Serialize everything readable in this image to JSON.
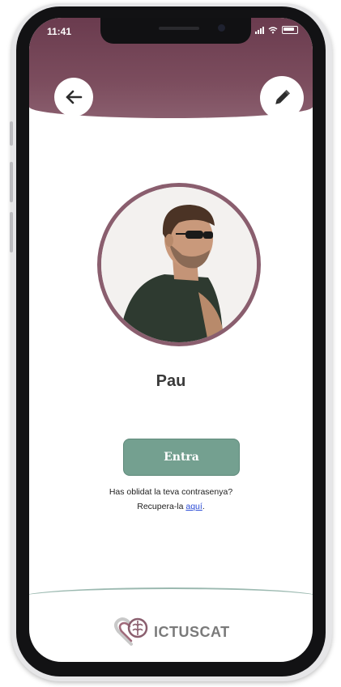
{
  "status_bar": {
    "time": "11:41"
  },
  "header": {
    "back_icon": "arrow-left-icon",
    "edit_icon": "pencil-icon"
  },
  "profile": {
    "name": "Pau"
  },
  "login": {
    "enter_label": "Entra",
    "forgot_text": "Has oblidat la teva contrasenya?",
    "recover_prefix": "Recupera-la ",
    "recover_link": "aquí",
    "recover_suffix": "."
  },
  "footer": {
    "brand": "ICTUSCAT"
  },
  "colors": {
    "header": "#6a3b4e",
    "avatar_ring": "#8a5e6e",
    "enter_button": "#74a090",
    "link": "#2a4bd6"
  }
}
